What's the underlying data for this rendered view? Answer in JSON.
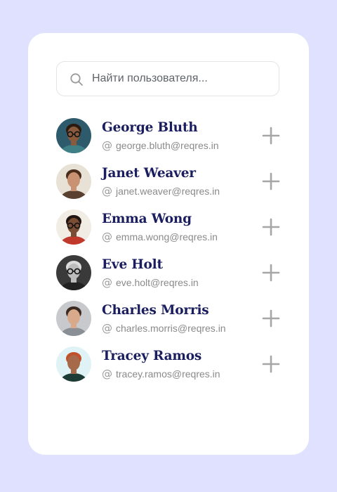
{
  "search": {
    "placeholder": "Найти пользователя...",
    "value": ""
  },
  "users": [
    {
      "name": "George Bluth",
      "email": "george.bluth@reqres.in",
      "avatar": {
        "bg": "#2e5b6b",
        "skin": "#8a5a3c",
        "hair": "#2a1a10",
        "shirt": "#3f7f86",
        "glasses": true
      }
    },
    {
      "name": "Janet Weaver",
      "email": "janet.weaver@reqres.in",
      "avatar": {
        "bg": "#e8e2d6",
        "skin": "#c99373",
        "hair": "#4a2c1a",
        "shirt": "#5a4030",
        "glasses": false
      }
    },
    {
      "name": "Emma Wong",
      "email": "emma.wong@reqres.in",
      "avatar": {
        "bg": "#f1ece4",
        "skin": "#7a4e34",
        "hair": "#1f1410",
        "shirt": "#c0392b",
        "glasses": true
      }
    },
    {
      "name": "Eve Holt",
      "email": "eve.holt@reqres.in",
      "avatar": {
        "bg": "#3a3a3a",
        "skin": "#bdbdbd",
        "hair": "#dcdcdc",
        "shirt": "#222222",
        "glasses": true
      }
    },
    {
      "name": "Charles Morris",
      "email": "charles.morris@reqres.in",
      "avatar": {
        "bg": "#c7c9cc",
        "skin": "#d9a98c",
        "hair": "#3a2a22",
        "shirt": "#8a8f96",
        "glasses": false
      }
    },
    {
      "name": "Tracey Ramos",
      "email": "tracey.ramos@reqres.in",
      "avatar": {
        "bg": "#dff3f6",
        "skin": "#a66a4a",
        "hair": "#c2502a",
        "shirt": "#1e3c36",
        "glasses": false
      }
    }
  ],
  "icons": {
    "search": "search-icon",
    "at": "at-icon",
    "add": "plus-icon"
  },
  "colors": {
    "page_bg": "#dfe1ff",
    "card_bg": "#ffffff",
    "name_color": "#1b1e5e",
    "email_color": "#8a8a8a",
    "icon_color": "#a6a6a6"
  }
}
